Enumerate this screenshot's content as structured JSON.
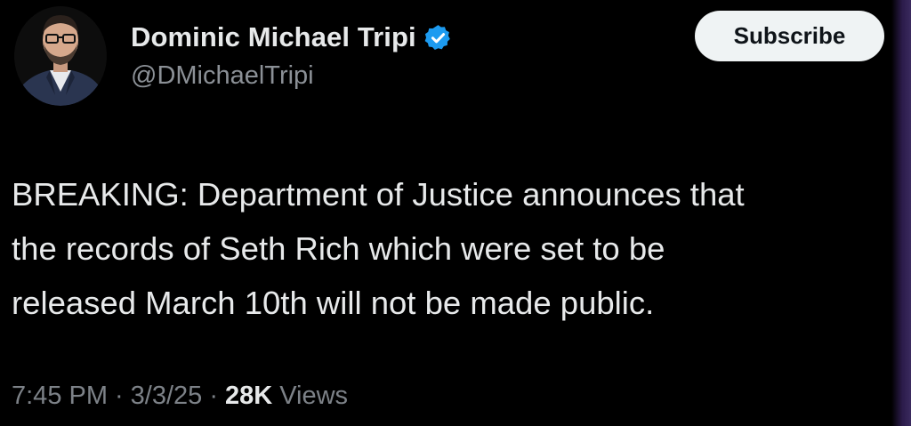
{
  "author": {
    "display_name": "Dominic Michael Tripi",
    "handle": "@DMichaelTripi",
    "verified": true,
    "verified_color": "#1d9bf0"
  },
  "subscribe_label": "Subscribe",
  "tweet": {
    "lines": [
      "BREAKING: Department of Justice announces that",
      "the records of Seth Rich which were set to be",
      "released March 10th will not be made public."
    ]
  },
  "meta": {
    "time": "7:45 PM",
    "separator": "·",
    "date": "3/3/25",
    "views_count": "28K",
    "views_label": "Views"
  },
  "colors": {
    "background": "#000000",
    "text_primary": "#e7e9ea",
    "text_secondary": "#8b9096",
    "button_bg": "#eff3f4"
  }
}
